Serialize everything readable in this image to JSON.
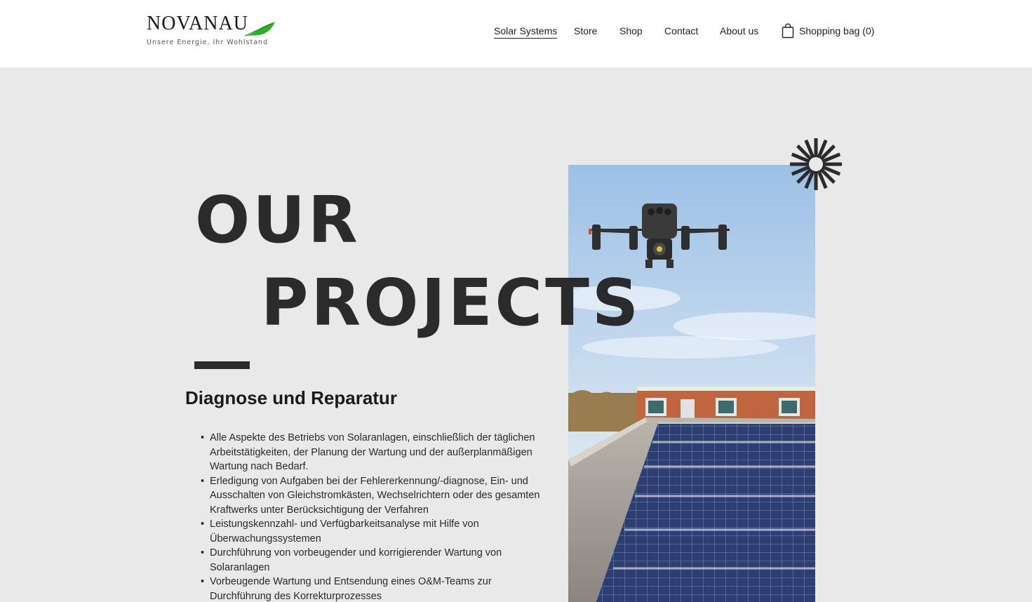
{
  "brand": {
    "name": "NOVANAU",
    "tagline": "Unsere Energie, Ihr Wohlstand"
  },
  "nav": {
    "items": [
      "Solar Systems",
      "Store",
      "Shop",
      "Contact",
      "About us"
    ],
    "active": "Solar Systems",
    "bag_label": "Shopping bag (0)"
  },
  "hero": {
    "line1": "OUR",
    "line2": "PROJECTS"
  },
  "section": {
    "title": "Diagnose und Reparatur",
    "bullets": [
      "Alle Aspekte des Betriebs von Solaranlagen, einschließlich der täglichen Arbeitstätigkeiten, der Planung der Wartung und der außerplanmäßigen Wartung nach Bedarf.",
      "Erledigung von Aufgaben bei der Fehlererkennung/-diagnose, Ein- und Ausschalten von Gleichstromkästen, Wechselrichtern oder des gesamten Kraftwerks unter Berücksichtigung der Verfahren",
      "Leistungskennzahl- und Verfügbarkeitsanalyse mit Hilfe von Überwachungssystemen",
      "Durchführung von vorbeugender und korrigierender Wartung von Solaranlagen",
      "Vorbeugende Wartung und Entsendung eines O&M-Teams zur Durchführung des Korrekturprozesses"
    ]
  },
  "colors": {
    "page_bg": "#e9e9e9",
    "header_bg": "#ffffff",
    "heading": "#2b2b2e",
    "leaf_green": "#2eae2b"
  },
  "icons": {
    "bag": "shopping-bag-icon",
    "decor": "sunburst-icon",
    "leaf": "leaf-icon"
  }
}
